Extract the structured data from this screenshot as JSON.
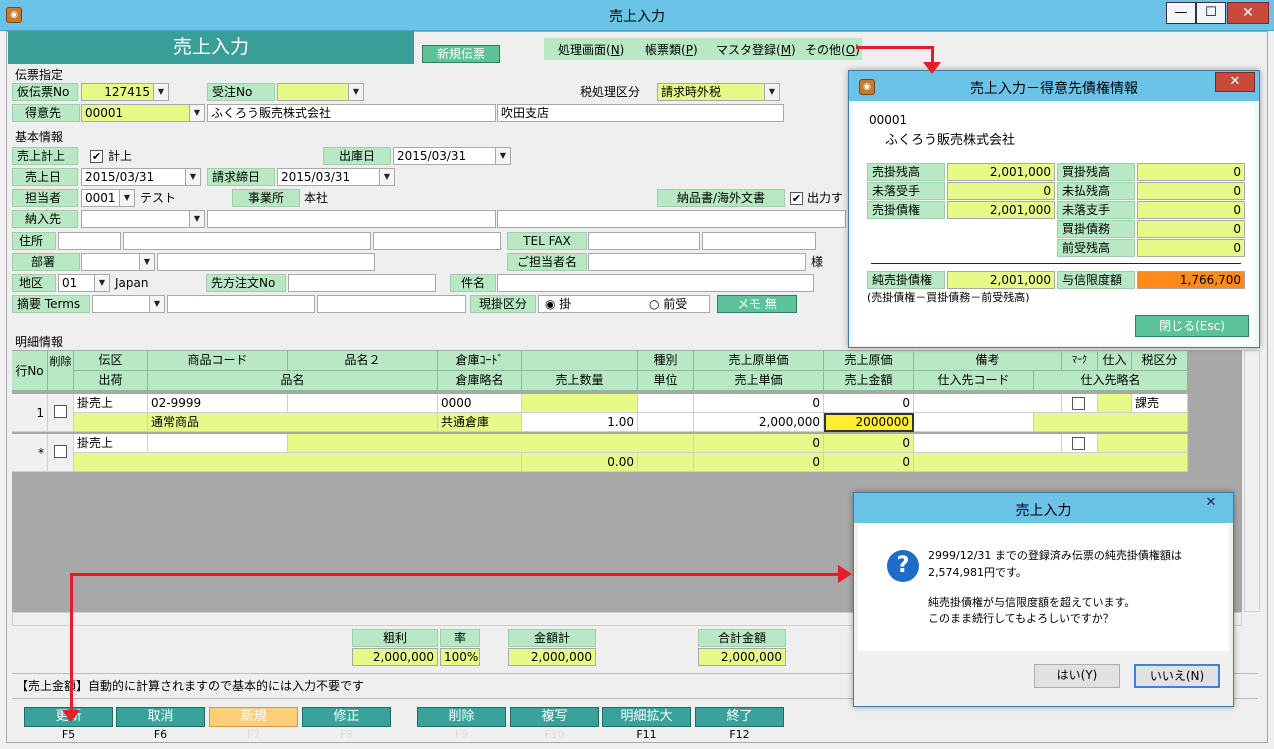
{
  "window": {
    "title": "売上入力",
    "minimize": "—",
    "maximize": "☐",
    "close": "✕"
  },
  "banner": "売上入力",
  "new_slip_button": "新規伝票",
  "menus": [
    {
      "label": "処理画面(",
      "key": "N",
      "tail": ")"
    },
    {
      "label": "帳票類(",
      "key": "P",
      "tail": ")"
    },
    {
      "label": "マスタ登録(",
      "key": "M",
      "tail": ")"
    },
    {
      "label": "その他(",
      "key": "O",
      "tail": ")"
    }
  ],
  "slip": {
    "section": "伝票指定",
    "temp_no_label": "仮伝票No",
    "temp_no": "127415",
    "order_no_label": "受注No",
    "order_no": "",
    "tax_label": "税処理区分",
    "tax_value": "請求時外税",
    "customer_label": "得意先",
    "customer_code": "00001",
    "customer_name": "ふくろう販売株式会社",
    "branch": "吹田支店"
  },
  "basic": {
    "section": "基本情報",
    "sales_post_label": "売上計上",
    "sales_post_check": "✔",
    "sales_post_text": "計上",
    "ship_date_label": "出庫日",
    "ship_date": "2015/03/31",
    "sales_date_label": "売上日",
    "sales_date": "2015/03/31",
    "closing_label": "請求締日",
    "closing_date": "2015/03/31",
    "person_label": "担当者",
    "person_code": "0001",
    "person_name": "テスト",
    "office_label": "事業所",
    "office_value": "本社",
    "delivery_doc_label": "納品書/海外文書",
    "delivery_doc_check": "✔",
    "delivery_doc_text": "出力す",
    "deliver_to_label": "納入先",
    "address_label": "住所",
    "telfax_label": "TEL FAX",
    "dept_label": "部署",
    "contact_label": "ご担当者名",
    "contact_suffix": "様",
    "region_label": "地区",
    "region_code": "01",
    "region_name": "Japan",
    "po_label": "先方注文No",
    "subject_label": "件名",
    "memo_label": "摘要 Terms",
    "cash_label": "現掛区分",
    "cash_radio1": "掛",
    "cash_radio2": "前受",
    "memo_button": "メモ 無"
  },
  "detail": {
    "section": "明細情報",
    "head1": [
      "行No",
      "削除",
      "伝区",
      "商品コード",
      "品名２",
      "倉庫ｺｰﾄﾞ",
      "",
      "種別",
      "売上原単価",
      "売上原価",
      "備考",
      "ﾏｰｸ",
      "仕入",
      "税区分"
    ],
    "head2": [
      "出荷",
      "品名",
      "倉庫略名",
      "売上数量",
      "単位",
      "売上単価",
      "売上金額",
      "仕入先コード",
      "仕入先略名"
    ],
    "row1": {
      "no": "1",
      "kind": "掛売上",
      "code": "02-9999",
      "wh_code": "0000",
      "cost_unit": "0",
      "cost": "0",
      "tax": "課売",
      "name": "通常商品",
      "wh_name": "共通倉庫",
      "qty": "1.00",
      "unit_price": "2,000,000",
      "amount": "2000000"
    },
    "row2": {
      "no": "*",
      "kind": "掛売上",
      "cost_unit": "0",
      "cost": "0",
      "qty": "0.00",
      "unit_price": "0",
      "amount": "0"
    }
  },
  "totals": {
    "gross_label": "粗利",
    "gross": "2,000,000",
    "rate_label": "率",
    "rate": "100%",
    "sum_label": "金額計",
    "sum": "2,000,000",
    "total_label": "合計金額",
    "total": "2,000,000"
  },
  "status_text": "【売上金額】自動的に計算されますので基本的には入力不要です",
  "fkeys": [
    {
      "label": "更新",
      "key": "F5"
    },
    {
      "label": "取消",
      "key": "F6"
    },
    {
      "label": "新規",
      "key": "F7"
    },
    {
      "label": "修正",
      "key": "F8"
    },
    {
      "label": "削除",
      "key": "F9"
    },
    {
      "label": "複写",
      "key": "F10"
    },
    {
      "label": "明細拡大",
      "key": "F11"
    },
    {
      "label": "終了",
      "key": "F12"
    }
  ],
  "credit_dialog": {
    "title": "売上入力－得意先債権情報",
    "close": "✕",
    "code": "00001",
    "name": "ふくろう販売株式会社",
    "rows": [
      {
        "l": "売掛残高",
        "v": "2,001,000",
        "l2": "買掛残高",
        "v2": "0"
      },
      {
        "l": "未落受手",
        "v": "0",
        "l2": "未払残高",
        "v2": "0"
      },
      {
        "l": "売掛債権",
        "v": "2,001,000",
        "l2": "未落支手",
        "v2": "0"
      },
      {
        "l": "",
        "v": "",
        "l2": "買掛債務",
        "v2": "0"
      },
      {
        "l": "",
        "v": "",
        "l2": "前受残高",
        "v2": "0"
      }
    ],
    "net_label": "純売掛債権",
    "net_value": "2,001,000",
    "limit_label": "与信限度額",
    "limit_value": "1,766,700",
    "formula": "(売掛債権－買掛債務－前受残高)",
    "close_button": "閉じる(Esc)"
  },
  "confirm_dialog": {
    "title": "売上入力",
    "close": "✕",
    "icon": "?",
    "line1": "2999/12/31 までの登録済み伝票の純売掛債権額は",
    "line2": "2,574,981円です。",
    "line3": "純売掛債権が与信限度額を超えています。",
    "line4": "このまま続行してもよろしいですか？",
    "yes": "はい(Y)",
    "no": "いいえ(N)"
  },
  "colors": {
    "accent": "#3a9e98",
    "label_bg": "#b8e8c4",
    "input_yellow": "#e6fa8a",
    "limit_orange": "#ff8a1c",
    "arrow_red": "#e31e24"
  }
}
